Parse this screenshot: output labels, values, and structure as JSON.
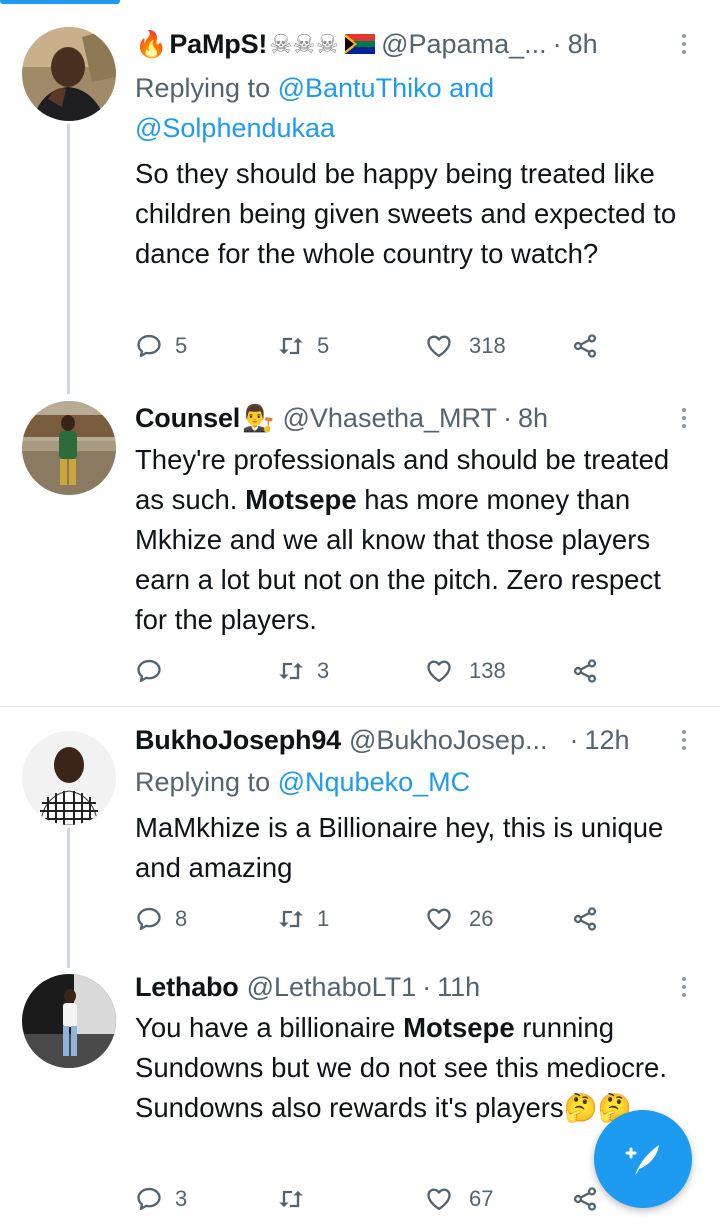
{
  "tweets": [
    {
      "name": "PaMpS!",
      "name_emoji_prefix": "🔥",
      "name_emoji_suffix": "☠☠☠",
      "flag": "south-africa-flag",
      "handle": "@Papama_...",
      "time": "8h",
      "replying_to_prefix": "Replying to",
      "replying_to_mentions": "@BantuThiko and",
      "replying_to_mentions2": "@Solphendukaa",
      "text": "So they should be happy being treated like children being given sweets and expected to dance for the whole country to watch?",
      "replies": "5",
      "retweets": "5",
      "likes": "318"
    },
    {
      "name": "Counsel",
      "name_emoji_suffix": "👨‍⚖️",
      "handle": "@Vhasetha_MRT",
      "time": "8h",
      "text_before": "They're professionals and should be treated as such. ",
      "text_bold": "Motsepe",
      "text_after": " has more money than Mkhize and we all know that those players earn a lot but not on the pitch. Zero respect for the players.",
      "replies": "",
      "retweets": "3",
      "likes": "138"
    },
    {
      "name": "BukhoJoseph94",
      "handle": "@BukhoJosep...",
      "time": "12h",
      "replying_to_prefix": "Replying to",
      "replying_to_mentions": "@Nqubeko_MC",
      "text": "MaMkhize is a Billionaire hey, this is unique and amazing",
      "replies": "8",
      "retweets": "1",
      "likes": "26"
    },
    {
      "name": "Lethabo",
      "handle": "@LethaboLT1",
      "time": "11h",
      "text_before": "You have a billionaire ",
      "text_bold": "Motsepe",
      "text_after": " running Sundowns but we do not see this mediocre. Sundowns also rewards it's players",
      "text_emoji": "🤔🤔",
      "replies": "3",
      "retweets": "",
      "likes": "67"
    }
  ],
  "separator": "·",
  "colors": {
    "accent": "#1d9bf0",
    "text": "#0f1419",
    "secondary": "#536471",
    "divider": "#e6ecf0"
  },
  "icons": {
    "reply": "reply-icon",
    "retweet": "retweet-icon",
    "like": "heart-icon",
    "share": "share-icon",
    "more": "more-vertical-icon",
    "compose": "compose-tweet-icon"
  }
}
